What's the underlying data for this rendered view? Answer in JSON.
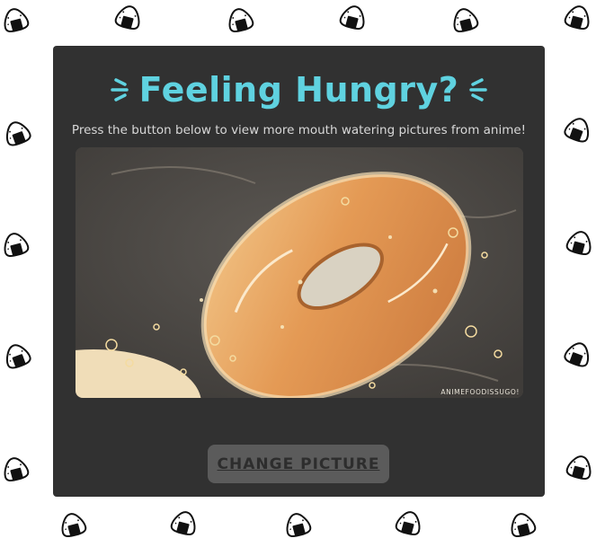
{
  "header": {
    "title": "Feeling Hungry?"
  },
  "intro": {
    "text": "Press the button below to view more mouth watering pictures from anime!"
  },
  "picture": {
    "subject": "glazed donut frying in oil",
    "watermark": "ANIMEFOODISSUGO!"
  },
  "controls": {
    "change_label": "CHANGE PICTURE"
  },
  "colors": {
    "background": "#ffffff",
    "card": "#313131",
    "title": "#5fd2e0",
    "button": "#5b5b5b"
  },
  "icons": {
    "background_pattern": "onigiri-icon",
    "title_decoration": "sparkle-icon"
  }
}
